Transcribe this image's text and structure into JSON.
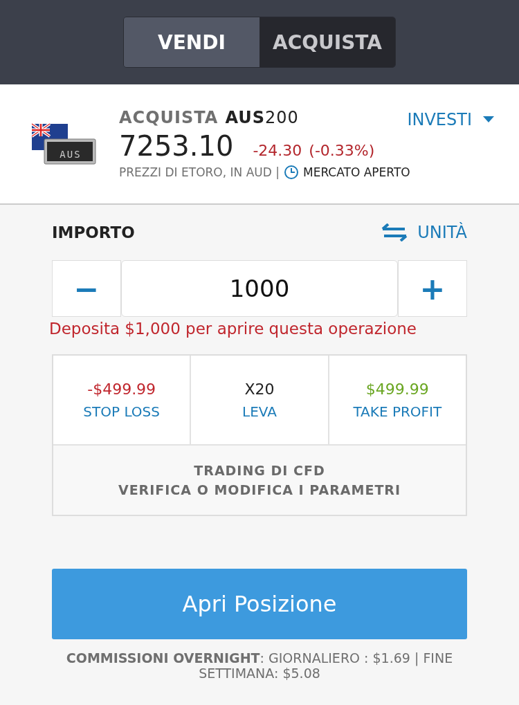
{
  "tabs": [
    {
      "label": "VENDI",
      "selected": false
    },
    {
      "label": "ACQUISTA",
      "selected": true
    }
  ],
  "instrument": {
    "action": "ACQUISTA",
    "symbol": "**AUS**200",
    "price": "7253.10",
    "change": "-24.30",
    "change_percent": "(-0.33%)",
    "source": "PREZZI DI ETORO, IN AUD |",
    "market_status": "MERCATO APERTO",
    "invest_menu": "INVESTI",
    "flag_label": "AUS"
  },
  "amount": {
    "label": "IMPORTO",
    "units_toggle": "UNITÀ",
    "minus": "−",
    "value": "1000",
    "plus": "+",
    "warning": "Deposita $1,000 per aprire questa operazione"
  },
  "parameters": [
    {
      "value": "-$499.99",
      "label": "STOP LOSS",
      "color": "#c0262d"
    },
    {
      "value": "X20",
      "label": "LEVA",
      "color": "#222222"
    },
    {
      "value": "$499.99",
      "label": "TAKE PROFIT",
      "color": "#6aa622"
    }
  ],
  "cfd_note": [
    "TRADING DI CFD",
    "VERIFICA O MODIFICA I PARAMETRI"
  ],
  "open_button": "Apri Posizione",
  "fees": "**COMMISSIONI OVERNIGHT**: GIORNALIERO : $1.69 | FINE SETTIMANA: $5.08"
}
